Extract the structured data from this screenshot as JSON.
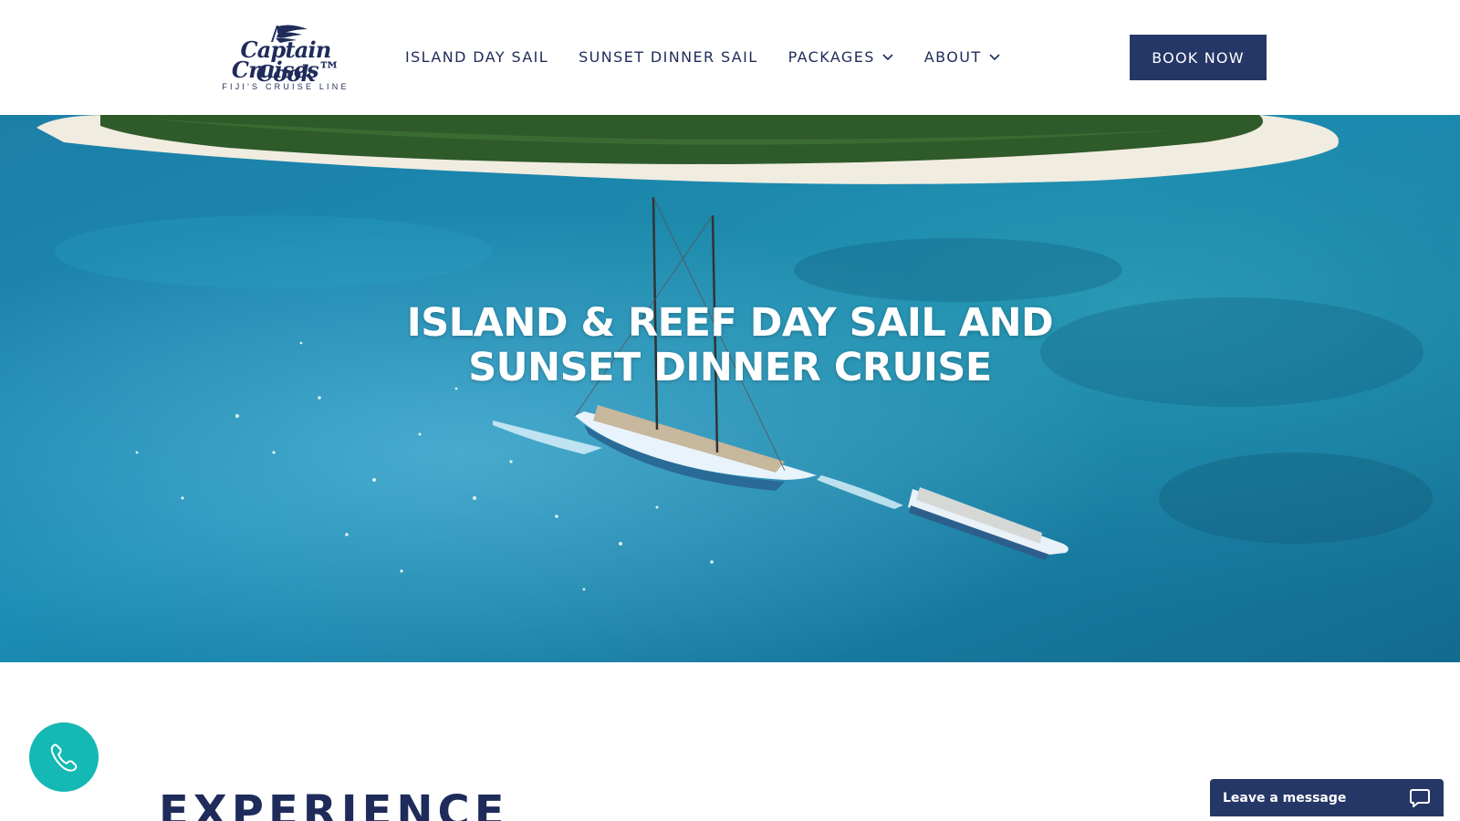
{
  "brand": {
    "name_line1": "Captain Cook",
    "name_line2": "Cruises™",
    "tagline": "FIJI'S CRUISE LINE"
  },
  "nav": {
    "items": [
      {
        "label": "ISLAND DAY SAIL",
        "has_dropdown": false
      },
      {
        "label": "SUNSET DINNER SAIL",
        "has_dropdown": false
      },
      {
        "label": "PACKAGES",
        "has_dropdown": true
      },
      {
        "label": "ABOUT",
        "has_dropdown": true
      }
    ],
    "cta_label": "BOOK NOW"
  },
  "hero": {
    "title_line1": "ISLAND & REEF DAY SAIL AND",
    "title_line2": "SUNSET DINNER CRUISE"
  },
  "section": {
    "heading": "EXPERIENCE"
  },
  "chat": {
    "label": "Leave a message"
  },
  "colors": {
    "navy": "#253766",
    "text_navy": "#1f2b5a",
    "teal": "#14b8b4",
    "white": "#ffffff"
  },
  "icons": {
    "phone": "phone-icon",
    "chat": "chat-bubble-icon",
    "dropdown": "chevron-down-icon"
  }
}
